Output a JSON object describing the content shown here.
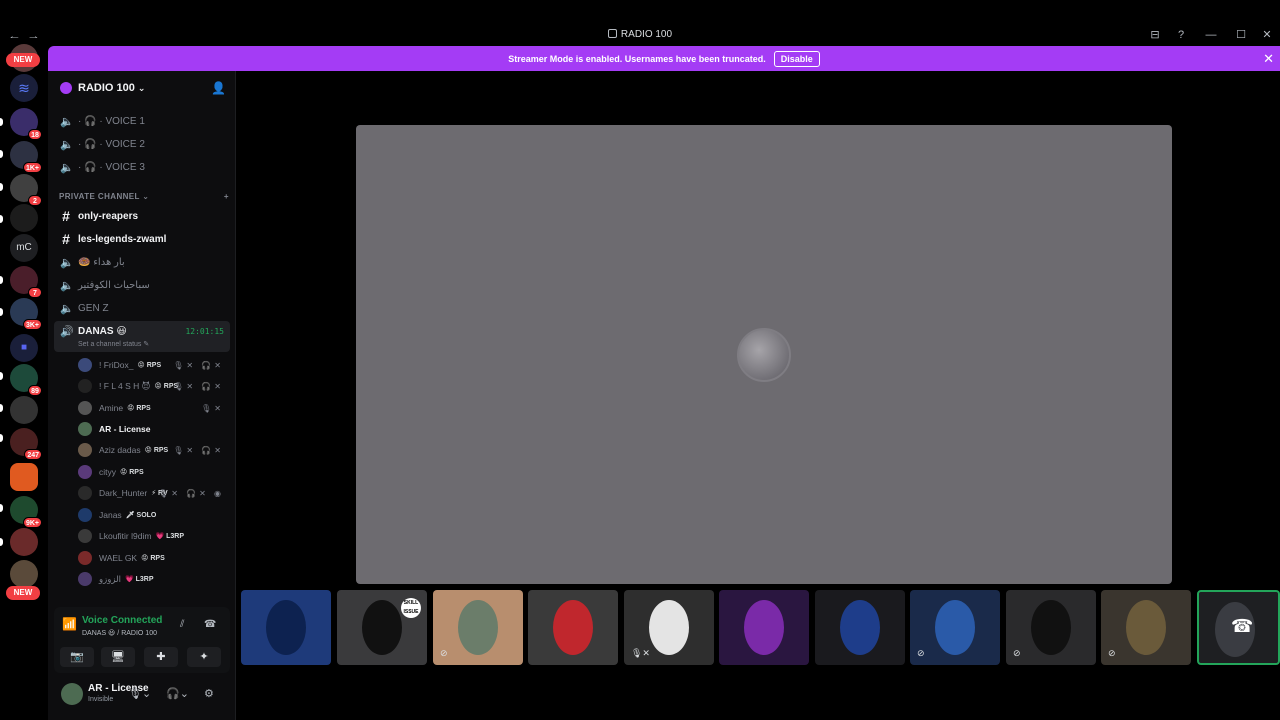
{
  "window": {
    "title": "RADIO 100",
    "nav_back": "←",
    "nav_forward": "→",
    "controls": [
      "⊟",
      "?",
      "—",
      "☐",
      "✕"
    ]
  },
  "banner": {
    "text": "Streamer Mode is enabled. Usernames have been truncated.",
    "disable_label": "Disable",
    "close": "✕"
  },
  "rail": {
    "new_top": "NEW",
    "new_bottom": "NEW",
    "server_text_mc": "mC",
    "badges": [
      "18",
      "1K+",
      "2",
      "7",
      "3K+",
      "89",
      "247",
      "9K+"
    ]
  },
  "guild": {
    "name": "RADIO 100",
    "chevron": "⌄"
  },
  "channels": {
    "voice": [
      {
        "label": "· 🎧 · VOICE 1"
      },
      {
        "label": "· 🎧 · VOICE 2"
      },
      {
        "label": "· 🎧 · VOICE 3"
      }
    ],
    "category": "PRIVATE CHANNEL",
    "category_add": "+",
    "text": [
      {
        "label": "only-reapers"
      },
      {
        "label": "les-legends-zwaml"
      }
    ],
    "private_voice": [
      {
        "label": "🍩 بار هداء"
      },
      {
        "label": "سباحيات الكوفتير"
      },
      {
        "label": "GEN Z"
      }
    ],
    "active": {
      "name": "DANAS 😃",
      "timer": "12:01:15",
      "status": "Set a channel status ✎"
    }
  },
  "members": [
    {
      "name": "! FriDox_",
      "tag": "😡 RPS",
      "icons": "🎙✕ 🎧✕"
    },
    {
      "name": "! F L 4 S H 😈",
      "tag": "😡 RPS",
      "icons": "🎙✕ 🎧✕"
    },
    {
      "name": "Amine",
      "tag": "😡 RPS",
      "icons": "🎙✕"
    },
    {
      "name": "AR - License",
      "tag": "",
      "icons": ""
    },
    {
      "name": "Aziz dadas",
      "tag": "😡 RPS",
      "icons": "🎙✕ 🎧✕"
    },
    {
      "name": "cityy",
      "tag": "😡 RPS",
      "icons": ""
    },
    {
      "name": "Dark_Hunter",
      "tag": "⚡ RV",
      "icons": "🎙✕ 🎧✕ ◉"
    },
    {
      "name": "Janas",
      "tag": "🗡 SOLO",
      "icons": ""
    },
    {
      "name": "Lkoufitir l9dim",
      "tag": "💗 L3RP",
      "icons": ""
    },
    {
      "name": "WAEL GK",
      "tag": "😡 RPS",
      "icons": ""
    },
    {
      "name": "الزوزو",
      "tag": "💗 L3RP",
      "icons": ""
    }
  ],
  "voice_panel": {
    "title": "Voice Connected",
    "subtitle": "DANAS 😃 / RADIO 100",
    "buttons": [
      "📷",
      "🖥",
      "✚",
      "✦"
    ]
  },
  "user": {
    "name": "AR - License",
    "status": "Invisible"
  },
  "colors": {
    "banner": "#a43cf5",
    "connected": "#23a55a",
    "badge": "#f23f43",
    "stage": "#6d6b70"
  }
}
